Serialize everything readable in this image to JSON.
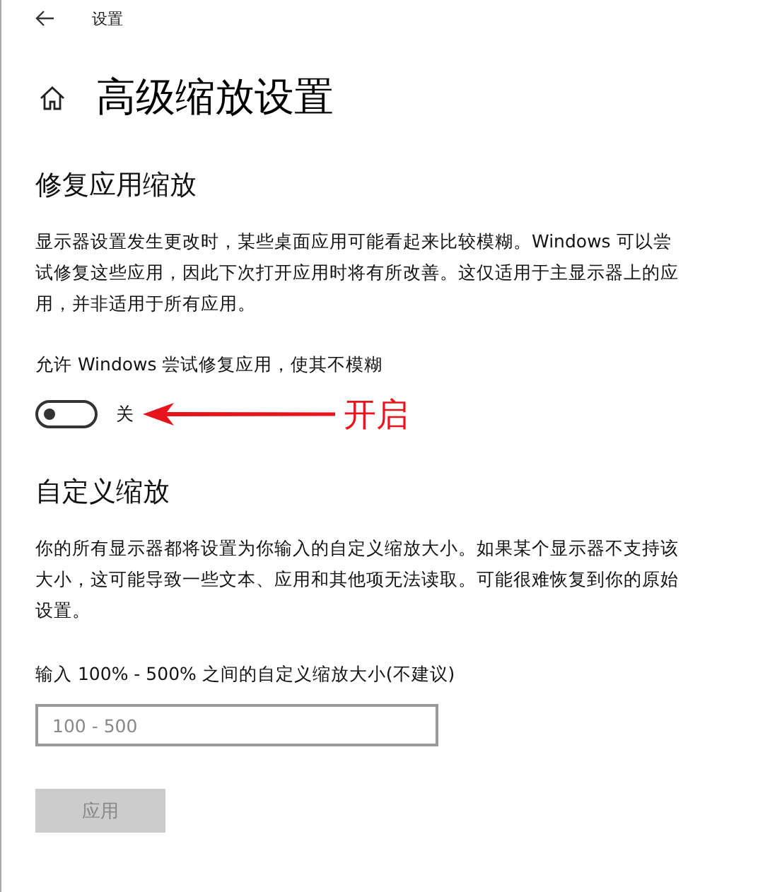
{
  "header": {
    "back_label": "设置"
  },
  "page": {
    "title": "高级缩放设置"
  },
  "fix_section": {
    "heading": "修复应用缩放",
    "description": "显示器设置发生更改时，某些桌面应用可能看起来比较模糊。Windows 可以尝试修复这些应用，因此下次打开应用时将有所改善。这仅适用于主显示器上的应用，并非适用于所有应用。",
    "toggle_label": "允许 Windows 尝试修复应用，使其不模糊",
    "toggle": {
      "on": false,
      "state_text": "关"
    },
    "annotation": "开启"
  },
  "custom_section": {
    "heading": "自定义缩放",
    "description": "你的所有显示器都将设置为你输入的自定义缩放大小。如果某个显示器不支持该大小，这可能导致一些文本、应用和其他项无法读取。可能很难恢复到你的原始设置。",
    "field_label": "输入 100% - 500% 之间的自定义缩放大小(不建议)",
    "field": {
      "placeholder": "100 - 500"
    },
    "apply_button": {
      "label": "应用",
      "disabled": true
    }
  }
}
